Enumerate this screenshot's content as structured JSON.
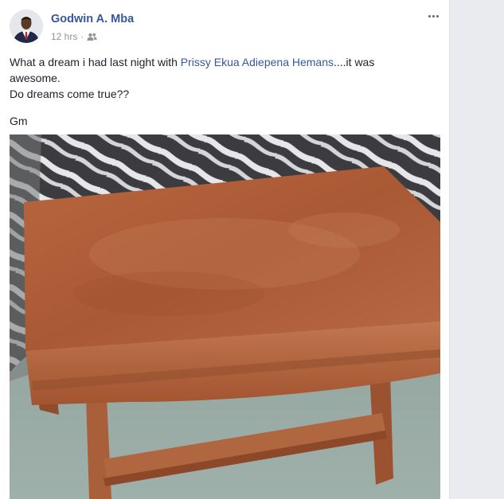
{
  "post": {
    "author_name": "Godwin A. Mba",
    "time": "12 hrs",
    "separator": "·",
    "audience_icon": "friends-icon",
    "more_icon": "more-options-icon",
    "text_before_mention": "What a dream i had last night with ",
    "mention": "Prissy Ekua Adiepena Hemans",
    "text_after_mention": "....it was awesome.",
    "line_2": "Do dreams come true??",
    "line_3": "Gm",
    "photo_subject": "wooden table"
  }
}
